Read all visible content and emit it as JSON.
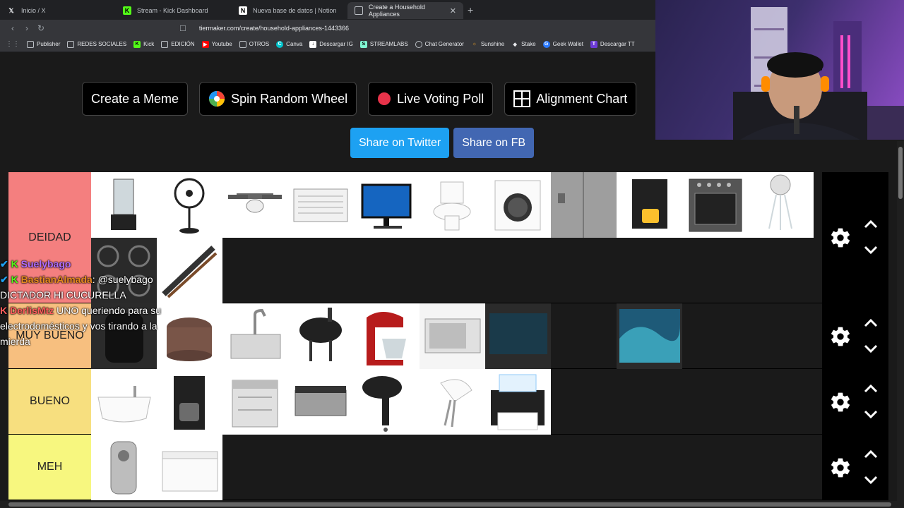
{
  "browser": {
    "tabs": [
      {
        "title": "Inicio / X",
        "favicon": "x-logo-icon",
        "active": false
      },
      {
        "title": "Stream - Kick Dashboard",
        "favicon": "kick-logo-icon",
        "active": false
      },
      {
        "title": "Nueva base de datos | Notion",
        "favicon": "notion-logo-icon",
        "active": false
      },
      {
        "title": "Create a Household Appliances",
        "favicon": "tiermaker-icon",
        "active": true
      }
    ],
    "new_tab": "+",
    "url": "tiermaker.com/create/household-appliances-1443366",
    "bookmarks": [
      {
        "label": "Publisher",
        "icon": "folder-icon"
      },
      {
        "label": "REDES SOCIALES",
        "icon": "folder-icon"
      },
      {
        "label": "Kick",
        "icon": "kick-logo-icon"
      },
      {
        "label": "EDICIÓN",
        "icon": "folder-icon"
      },
      {
        "label": "Youtube",
        "icon": "youtube-icon"
      },
      {
        "label": "OTROS",
        "icon": "folder-icon"
      },
      {
        "label": "Canva",
        "icon": "canva-icon"
      },
      {
        "label": "Descargar IG",
        "icon": "download-icon"
      },
      {
        "label": "STREAMLABS",
        "icon": "streamlabs-icon"
      },
      {
        "label": "Chat Generator",
        "icon": "chat-icon"
      },
      {
        "label": "Sunshine",
        "icon": "sun-icon"
      },
      {
        "label": "Stake",
        "icon": "stake-icon"
      },
      {
        "label": "Geek Wallet",
        "icon": "wallet-icon"
      },
      {
        "label": "Descargar TT",
        "icon": "tiktok-icon"
      }
    ]
  },
  "page": {
    "actions": [
      {
        "label": "Create a Meme",
        "icon": "none"
      },
      {
        "label": "Spin Random Wheel",
        "icon": "wheel-icon"
      },
      {
        "label": "Live Voting Poll",
        "icon": "red-dot-icon"
      },
      {
        "label": "Alignment Chart",
        "icon": "grid-icon"
      }
    ],
    "share": {
      "twitter": "Share on Twitter",
      "facebook": "Share on FB"
    }
  },
  "tiers": [
    {
      "label": "DEIDAD",
      "color": "#f47f7f",
      "items": [
        "blender",
        "standing-fan",
        "ceiling-fan",
        "window-ac",
        "desktop-computer",
        "toilet",
        "washing-machine",
        "refrigerator",
        "coffee-maker",
        "oven",
        "shower-head",
        "gas-stove",
        "hair-straightener"
      ]
    },
    {
      "label": "MUY BUENO",
      "color": "#f7bf7f",
      "items": [
        "air-fryer",
        "rice-cooker",
        "kitchen-sink",
        "bbq-grill",
        "stand-mixer",
        "toaster-oven",
        "tv-dim",
        "gap",
        "tv"
      ]
    },
    {
      "label": "BUENO",
      "color": "#f7df7f",
      "items": [
        "bathtub",
        "drip-coffee-maker",
        "dishwasher",
        "panini-grill",
        "hair-dryer",
        "hand-mixer",
        "printer"
      ]
    },
    {
      "label": "MEH",
      "color": "#f7f77f",
      "items": [
        "can-opener",
        "chest-freezer"
      ]
    }
  ],
  "chat": [
    {
      "user": "Suelybago",
      "user_color": "#b06cff",
      "message": ""
    },
    {
      "user": "BastianAlmada",
      "user_color": "#e58a1f",
      "message": ": @suelybago"
    },
    {
      "user": "",
      "user_color": "#ffffff",
      "message": "DICTADOR HI CUCURELLA"
    },
    {
      "user": "DerlisMtz",
      "user_color": "#ff5d5d",
      "message": " UNO queriendo para su"
    },
    {
      "user": "",
      "user_color": "#ffffff",
      "message": "electrodomésticos y vos tirando a la"
    },
    {
      "user": "",
      "user_color": "#ffffff",
      "message": "mierda"
    }
  ]
}
